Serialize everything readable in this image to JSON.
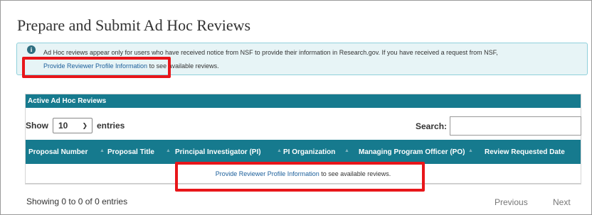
{
  "page": {
    "title": "Prepare and Submit Ad Hoc Reviews"
  },
  "info": {
    "icon": "info-circle-icon",
    "text_line1": "Ad Hoc reviews appear only for users who have received notice from NSF to provide their information in Research.gov. If you have received a request from NSF,",
    "link_label": "Provide Reviewer Profile Information",
    "text_line2_suffix": " to see available reviews."
  },
  "table": {
    "panel_title": "Active Ad Hoc Reviews",
    "show_label": "Show",
    "entries_value": "10",
    "entries_label": "entries",
    "search_label": "Search:",
    "search_value": "",
    "columns": [
      "Proposal Number",
      "Proposal Title",
      "Principal Investigator (PI)",
      "PI Organization",
      "Managing Program Officer (PO)",
      "Review Requested Date"
    ],
    "empty_link": "Provide Reviewer Profile Information",
    "empty_suffix": " to see available reviews."
  },
  "footer": {
    "info": "Showing 0 to 0 of 0 entries",
    "previous": "Previous",
    "next": "Next"
  },
  "colors": {
    "header_teal": "#167a8e",
    "info_bg": "#e7f4f6",
    "highlight_red": "#e8161a",
    "link": "#1a5e9a"
  }
}
